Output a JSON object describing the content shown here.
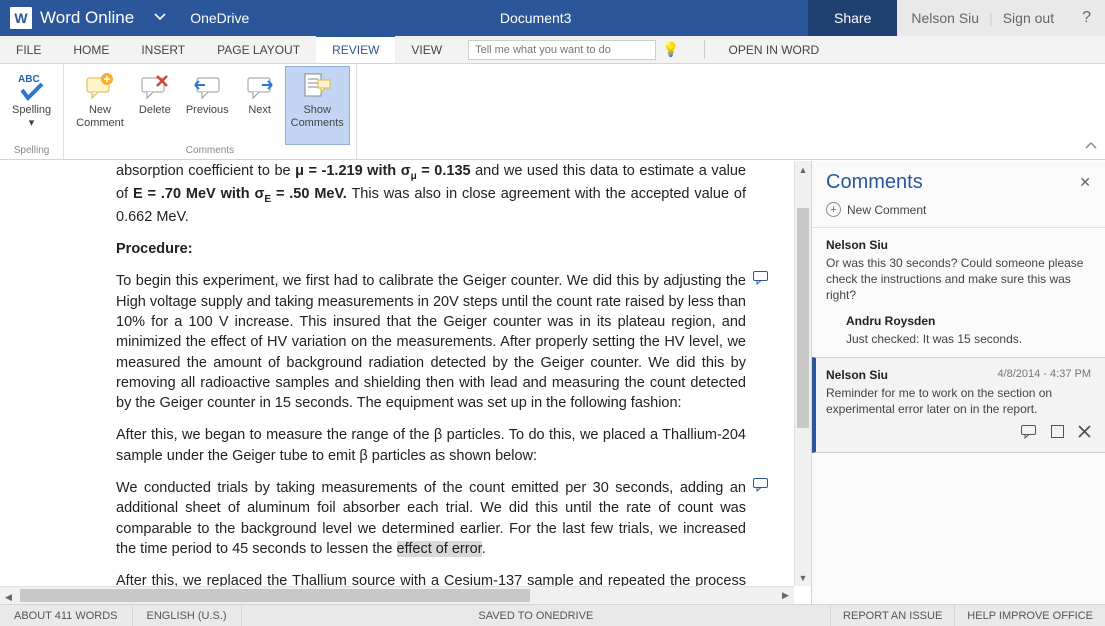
{
  "titlebar": {
    "app_name": "Word Online",
    "location": "OneDrive",
    "doc_title": "Document3",
    "share_label": "Share",
    "user_name": "Nelson Siu",
    "sign_out": "Sign out",
    "help": "?"
  },
  "tabs": {
    "file": "FILE",
    "home": "HOME",
    "insert": "INSERT",
    "page_layout": "PAGE LAYOUT",
    "review": "REVIEW",
    "view": "VIEW",
    "search_placeholder": "Tell me what you want to do",
    "open_in_word": "OPEN IN WORD"
  },
  "ribbon": {
    "spelling": {
      "label": "Spelling",
      "group": "Spelling"
    },
    "comments_group": "Comments",
    "new_comment": "New\nComment",
    "delete": "Delete",
    "previous": "Previous",
    "next": "Next",
    "show_comments": "Show\nComments"
  },
  "document": {
    "frag_top": "absorption coefficient to be μ = -1.219 with σμ = 0.135 and we used this data to estimate a value of E = .70 MeV with σE = .50 MeV.",
    "frag_top_tail": " This was also in close agreement with the accepted value of 0.662 MeV.",
    "procedure_hdr": "Procedure:",
    "p1": "To begin this experiment, we first had to calibrate the Geiger counter. We did this by adjusting the High voltage supply and taking measurements in 20V steps until the count rate raised by less than 10% for a 100 V increase. This insured that the Geiger counter was in its plateau region, and minimized the effect of HV variation on the measurements. After properly setting the HV level, we measured the amount of background radiation detected by the Geiger counter. We did this by removing all radioactive samples and shielding then with lead and measuring the count detected by the Geiger counter in 15 seconds. The equipment was set up in the following fashion:",
    "p2": "After this, we began to measure the range of the β particles. To do this, we placed a Thallium-204 sample under the Geiger tube to emit β particles as shown below:",
    "p3a": "We conducted trials by taking measurements of the count emitted per 30 seconds, adding an additional sheet of aluminum foil absorber each trial. We did this until the rate of count was comparable to the background level we determined earlier. For the last few trials, we increased the time period to 45 seconds to lessen the ",
    "p3_hl": "effect of error",
    "p3b": ".",
    "p4": "After this, we replaced the Thallium source with a Cesium-137 sample and repeated the process to measure the absorption of γ rays. For this, we used lead absorbers instead of aluminum ones."
  },
  "comments_pane": {
    "title": "Comments",
    "new_comment": "New Comment",
    "threads": [
      {
        "author": "Nelson Siu",
        "body": "Or was this 30 seconds?  Could someone please check the instructions and make sure this was right?",
        "replies": [
          {
            "author": "Andru Roysden",
            "body": "Just checked: It was 15 seconds."
          }
        ]
      },
      {
        "author": "Nelson Siu",
        "time": "4/8/2014 - 4:37 PM",
        "body": "Reminder for me to work on the section on experimental error later on in the report.",
        "selected": true
      }
    ]
  },
  "statusbar": {
    "words": "ABOUT 411 WORDS",
    "lang": "ENGLISH (U.S.)",
    "saved": "SAVED TO ONEDRIVE",
    "report": "REPORT AN ISSUE",
    "improve": "HELP IMPROVE OFFICE"
  }
}
